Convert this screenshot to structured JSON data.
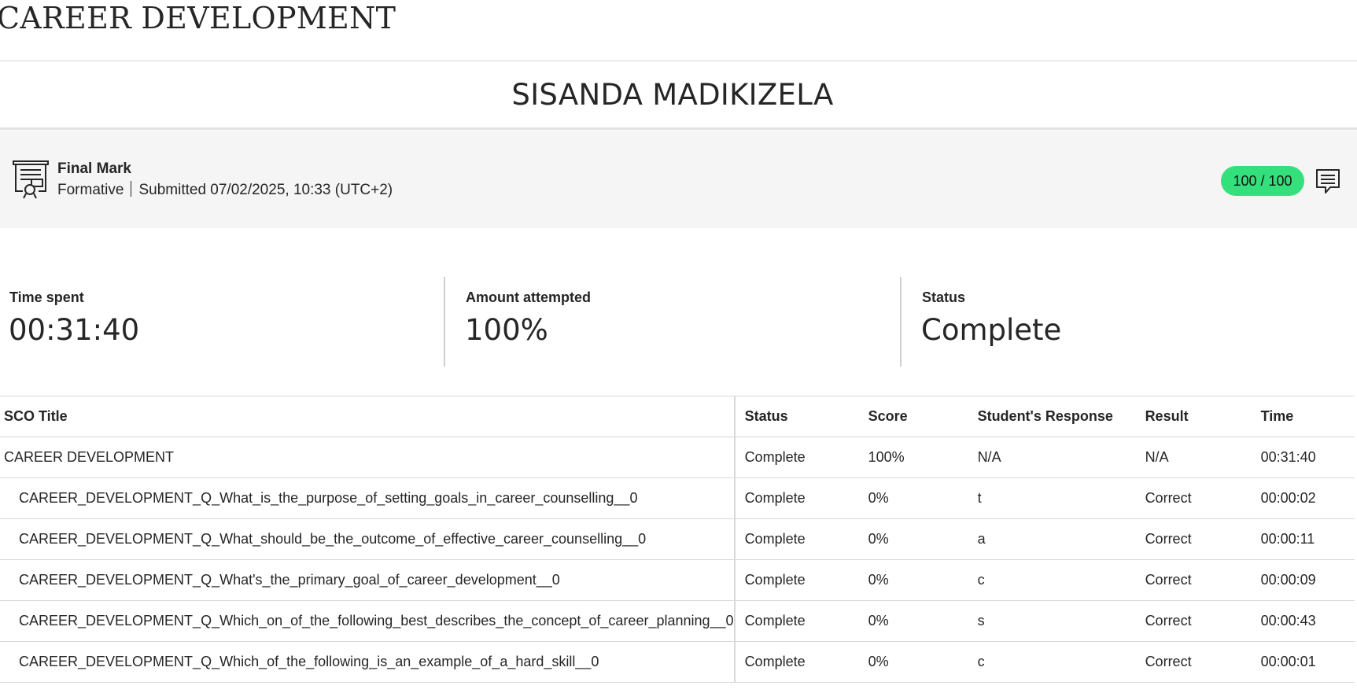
{
  "page": {
    "title": "CAREER DEVELOPMENT",
    "student_name": "SISANDA MADIKIZELA"
  },
  "summary": {
    "label": "Final Mark",
    "category": "Formative",
    "submitted": "Submitted 07/02/2025, 10:33 (UTC+2)",
    "score": "100 / 100",
    "score_color": "#34e07c",
    "icons": [
      "certificate-icon",
      "feedback-icon"
    ]
  },
  "stats": {
    "time_spent": {
      "label": "Time spent",
      "value": "00:31:40"
    },
    "amount_attempted": {
      "label": "Amount attempted",
      "value": "100%"
    },
    "status": {
      "label": "Status",
      "value": "Complete"
    }
  },
  "table": {
    "headers": [
      "SCO Title",
      "Status",
      "Score",
      "Student's Response",
      "Result",
      "Time"
    ],
    "rows": [
      [
        "CAREER DEVELOPMENT",
        "Complete",
        "100%",
        "N/A",
        "N/A",
        "00:31:40"
      ],
      [
        "CAREER_DEVELOPMENT_Q_What_is_the_purpose_of_setting_goals_in_career_counselling__0",
        "Complete",
        "0%",
        "t",
        "Correct",
        "00:00:02"
      ],
      [
        "CAREER_DEVELOPMENT_Q_What_should_be_the_outcome_of_effective_career_counselling__0",
        "Complete",
        "0%",
        "a",
        "Correct",
        "00:00:11"
      ],
      [
        "CAREER_DEVELOPMENT_Q_What's_the_primary_goal_of_career_development__0",
        "Complete",
        "0%",
        "c",
        "Correct",
        "00:00:09"
      ],
      [
        "CAREER_DEVELOPMENT_Q_Which_on_of_the_following_best_describes_the_concept_of_career_planning__0",
        "Complete",
        "0%",
        "s",
        "Correct",
        "00:00:43"
      ],
      [
        "CAREER_DEVELOPMENT_Q_Which_of_the_following_is_an_example_of_a_hard_skill__0",
        "Complete",
        "0%",
        "c",
        "Correct",
        "00:00:01"
      ]
    ]
  }
}
